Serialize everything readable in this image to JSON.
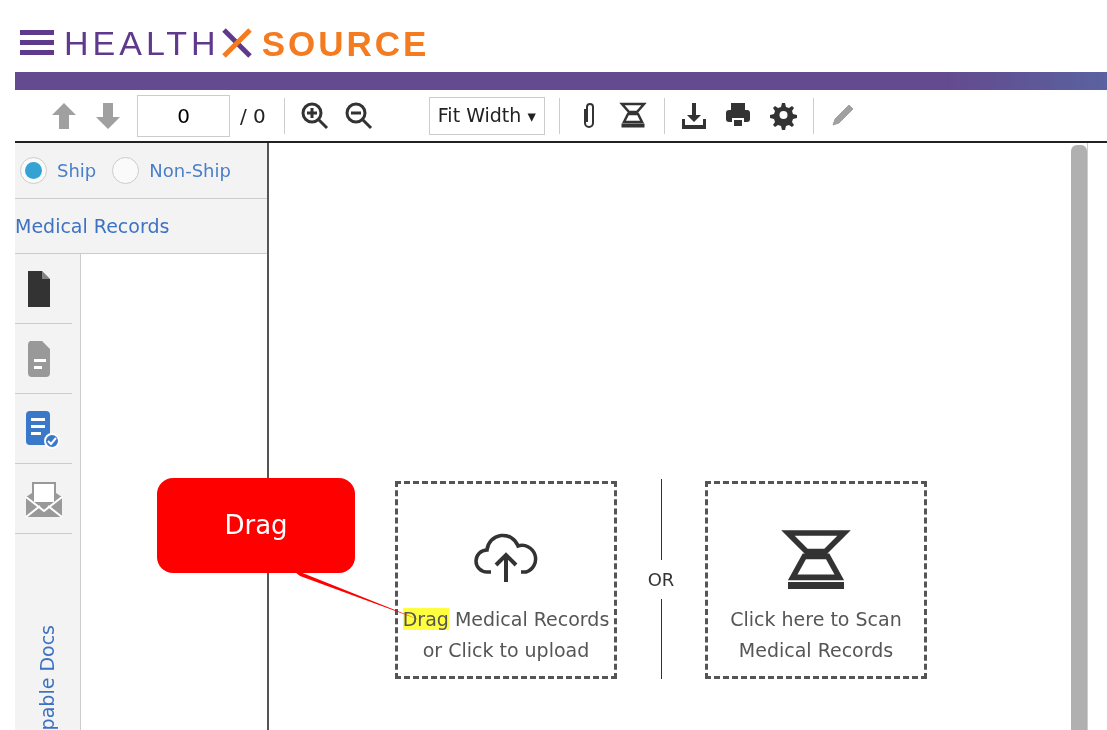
{
  "logo": {
    "word_1": "HEALTH",
    "word_2": "SOURCE"
  },
  "toolbar": {
    "items": [
      {
        "kind": "up",
        "disabled": true
      },
      {
        "kind": "down",
        "disabled": true
      },
      {
        "kind": "page",
        "value": "0",
        "total": "/ 0"
      },
      {
        "kind": "sep"
      },
      {
        "kind": "zoomin",
        "disabled": false
      },
      {
        "kind": "zoomout",
        "disabled": false
      },
      {
        "kind": "select",
        "value": "Fit Width",
        "caret": "▾"
      },
      {
        "kind": "sep"
      },
      {
        "kind": "attach",
        "disabled": false
      },
      {
        "kind": "scan",
        "disabled": false
      },
      {
        "kind": "sep"
      },
      {
        "kind": "download",
        "disabled": false
      },
      {
        "kind": "print",
        "disabled": false
      },
      {
        "kind": "settings",
        "disabled": false
      },
      {
        "kind": "sep"
      },
      {
        "kind": "edit",
        "disabled": true
      }
    ]
  },
  "radios": [
    {
      "label": "Ship",
      "selected": true
    },
    {
      "label": "Non-Ship",
      "selected": false
    }
  ],
  "section_title": "Medical Records",
  "doc_icons": [
    {
      "kind": "file",
      "color": "#333333"
    },
    {
      "kind": "filetext",
      "color": "#999999"
    },
    {
      "kind": "filecheck",
      "color": "#3a78c9"
    },
    {
      "kind": "envelope",
      "color": "#999999"
    }
  ],
  "vertical_tab": "pable Docs",
  "upload": {
    "highlight": "Drag",
    "rest": "Medical Records",
    "line2": "or Click to upload"
  },
  "or_label": "OR",
  "scan": {
    "line1": "Click here to Scan",
    "line2": "Medical Records"
  },
  "callout": {
    "text": "Drag"
  }
}
